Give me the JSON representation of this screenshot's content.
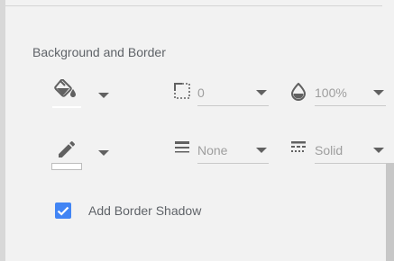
{
  "panel": {
    "section_title": "Background and Border",
    "fill": {
      "icon": "fill-color-icon",
      "swatch_color": "#ffffff",
      "dropdown_icon": "chevron-down-icon"
    },
    "border_radius": {
      "icon": "border-radius-icon",
      "value": "0"
    },
    "opacity": {
      "icon": "opacity-icon",
      "value": "100%"
    },
    "border_color": {
      "icon": "pen-icon",
      "swatch_color": "#ffffff",
      "dropdown_icon": "chevron-down-icon"
    },
    "border_weight": {
      "icon": "line-weight-icon",
      "value": "None"
    },
    "border_style": {
      "icon": "line-style-icon",
      "value": "Solid"
    },
    "shadow": {
      "checked": true,
      "label": "Add Border Shadow",
      "accent": "#4285f4"
    }
  }
}
